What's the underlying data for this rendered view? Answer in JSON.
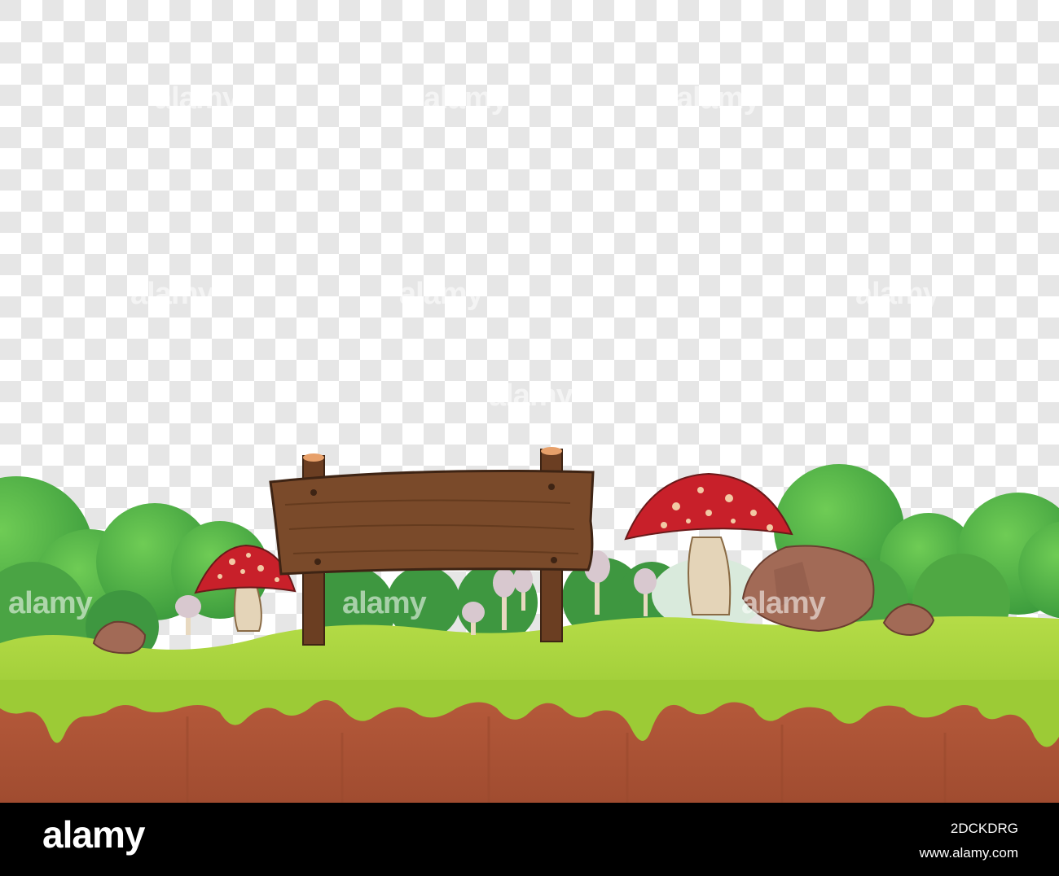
{
  "watermark": {
    "text": "alamy"
  },
  "footer": {
    "logo_text": "alamy",
    "image_id": "2DCKDRG",
    "url": "www.alamy.com"
  },
  "colors": {
    "checker_light": "#ffffff",
    "checker_dark": "#e6e6e6",
    "bush_dark": "#3f9a3f",
    "bush_mid": "#5cb84a",
    "bush_light": "#7fd05d",
    "grass": "#a6d13c",
    "grass_dark": "#8fbf2e",
    "cliff": "#b8593a",
    "cliff_dark": "#9c4a2f",
    "wood": "#7a4a2a",
    "wood_dark": "#5c3519",
    "mushroom_red": "#c8202a",
    "mushroom_spot": "#f2c9a4",
    "stem": "#e8d9c0",
    "rock": "#a26a56",
    "rock_dark": "#7d4f40",
    "footer_bg": "#000000"
  },
  "scene": {
    "sign_text": ""
  }
}
